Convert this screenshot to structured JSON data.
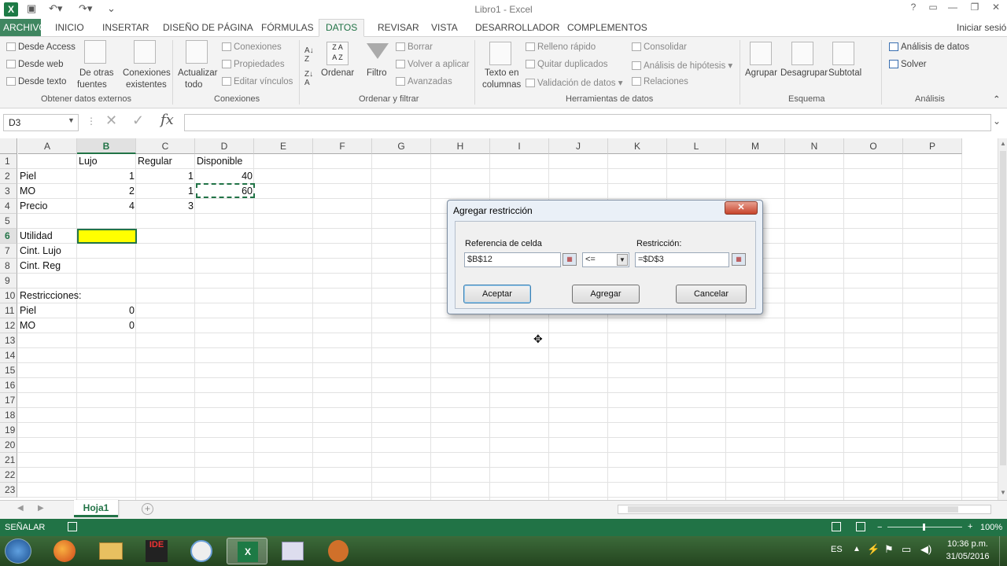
{
  "window": {
    "title": "Libro1 - Excel",
    "signin": "Iniciar sesión"
  },
  "tabs": [
    "ARCHIVO",
    "INICIO",
    "INSERTAR",
    "DISEÑO DE PÁGINA",
    "FÓRMULAS",
    "DATOS",
    "REVISAR",
    "VISTA",
    "DESARROLLADOR",
    "COMPLEMENTOS"
  ],
  "ribbon": {
    "ext": {
      "access": "Desde Access",
      "web": "Desde web",
      "text": "Desde texto",
      "other1": "De otras",
      "other2": "fuentes",
      "existing1": "Conexiones",
      "existing2": "existentes",
      "label": "Obtener datos externos"
    },
    "conn": {
      "refresh1": "Actualizar",
      "refresh2": "todo",
      "connections": "Conexiones",
      "properties": "Propiedades",
      "edit": "Editar vínculos",
      "label": "Conexiones"
    },
    "sort": {
      "sort": "Ordenar",
      "filter": "Filtro",
      "clear": "Borrar",
      "reapply": "Volver a aplicar",
      "advanced": "Avanzadas",
      "label": "Ordenar y filtrar"
    },
    "tools": {
      "t2c1": "Texto en",
      "t2c2": "columnas",
      "flash": "Relleno rápido",
      "dup": "Quitar duplicados",
      "valid": "Validación de datos",
      "consol": "Consolidar",
      "whatif": "Análisis de hipótesis",
      "rel": "Relaciones",
      "label": "Herramientas de datos"
    },
    "outline": {
      "group": "Agrupar",
      "ungroup": "Desagrupar",
      "subtotal": "Subtotal",
      "label": "Esquema"
    },
    "analysis": {
      "data": "Análisis de datos",
      "solver": "Solver",
      "label": "Análisis"
    }
  },
  "formula_bar": {
    "name_box": "D3",
    "formula": ""
  },
  "columns": [
    "A",
    "B",
    "C",
    "D",
    "E",
    "F",
    "G",
    "H",
    "I",
    "J",
    "K",
    "L",
    "M",
    "N",
    "O",
    "P"
  ],
  "rows": [
    "1",
    "2",
    "3",
    "4",
    "5",
    "6",
    "7",
    "8",
    "9",
    "10",
    "11",
    "12",
    "13",
    "14",
    "15",
    "16",
    "17",
    "18",
    "19",
    "20",
    "21",
    "22",
    "23"
  ],
  "cells": {
    "B1": "Lujo",
    "C1": "Regular",
    "D1": "Disponible",
    "A2": "Piel",
    "B2": "1",
    "C2": "1",
    "D2": "40",
    "A3": "MO",
    "B3": "2",
    "C3": "1",
    "D3": "60",
    "A4": "Precio",
    "B4": "4",
    "C4": "3",
    "A6": "Utilidad",
    "A7": "Cint. Lujo",
    "A8": "Cint. Reg",
    "A10": "Restricciones:",
    "A11": "Piel",
    "B11": "0",
    "A12": "MO",
    "B12": "0"
  },
  "colors": {
    "accent": "#217346",
    "highlight": "#ffff00"
  },
  "sheet": {
    "tab": "Hoja1"
  },
  "status": {
    "mode": "SEÑALAR",
    "zoom": "100%"
  },
  "dialog": {
    "title": "Agregar restricción",
    "cell_ref_label": "Referencia de celda",
    "cell_ref_value": "$B$12",
    "operator": "<=",
    "constraint_label": "Restricción:",
    "constraint_value": "=$D$3",
    "ok": "Aceptar",
    "add": "Agregar",
    "cancel": "Cancelar"
  },
  "taskbar": {
    "lang": "ES",
    "time": "10:36 p.m.",
    "date": "31/05/2016",
    "ide": "IDE"
  }
}
